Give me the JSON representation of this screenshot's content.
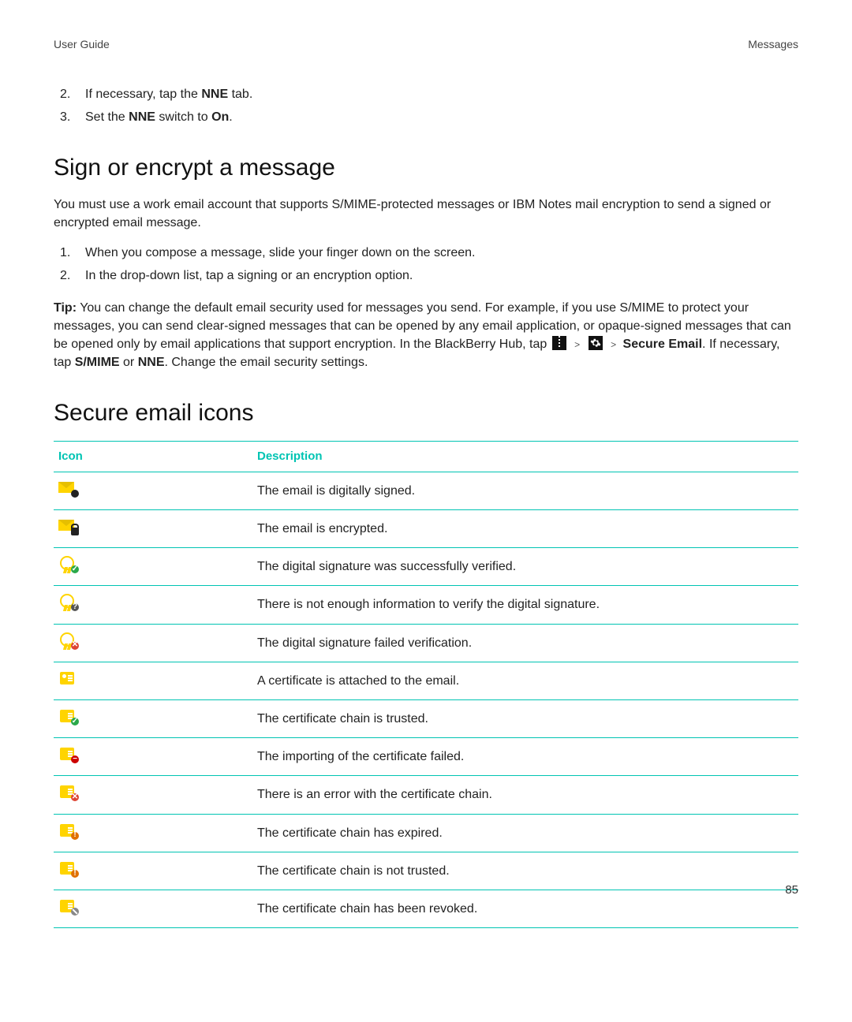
{
  "header": {
    "left": "User Guide",
    "right": "Messages"
  },
  "steps_top": [
    "If necessary, tap the **NNE** tab.",
    "Set the **NNE** switch to **On**."
  ],
  "section1": {
    "title": "Sign or encrypt a message",
    "intro": "You must use a work email account that supports S/MIME-protected messages or IBM Notes mail encryption to send a signed or encrypted email message.",
    "steps": [
      "When you compose a message, slide your finger down on the screen.",
      "In the drop-down list, tap a signing or an encryption option."
    ],
    "tip_prefix": "Tip:",
    "tip_body_a": " You can change the default email security used for messages you send. For example, if you use S/MIME to protect your messages, you can send clear-signed messages that can be opened by any email application, or opaque-signed messages that can be opened only by email applications that support encryption. In the BlackBerry Hub, tap ",
    "tip_secure_label": "Secure Email",
    "tip_body_b": ". If necessary, tap ",
    "tip_smime": "S/MIME",
    "tip_or": " or ",
    "tip_nne": "NNE",
    "tip_tail": ". Change the email security settings."
  },
  "section2": {
    "title": "Secure email icons",
    "columns": {
      "icon": "Icon",
      "desc": "Description"
    },
    "rows": [
      {
        "icon": "envelope-signed-icon",
        "desc": "The email is digitally signed."
      },
      {
        "icon": "envelope-encrypted-icon",
        "desc": "The email is encrypted."
      },
      {
        "icon": "signature-verified-icon",
        "desc": "The digital signature was successfully verified."
      },
      {
        "icon": "signature-unknown-icon",
        "desc": "There is not enough information to verify the digital signature."
      },
      {
        "icon": "signature-failed-icon",
        "desc": "The digital signature failed verification."
      },
      {
        "icon": "certificate-attached-icon",
        "desc": "A certificate is attached to the email."
      },
      {
        "icon": "cert-chain-trusted-icon",
        "desc": "The certificate chain is trusted."
      },
      {
        "icon": "cert-import-failed-icon",
        "desc": "The importing of the certificate failed."
      },
      {
        "icon": "cert-chain-error-icon",
        "desc": "There is an error with the certificate chain."
      },
      {
        "icon": "cert-chain-expired-icon",
        "desc": "The certificate chain has expired."
      },
      {
        "icon": "cert-chain-untrusted-icon",
        "desc": "The certificate chain is not trusted."
      },
      {
        "icon": "cert-chain-revoked-icon",
        "desc": "The certificate chain has been revoked."
      }
    ]
  },
  "page_number": "85",
  "colors": {
    "accent": "#00c4b3",
    "icon_yellow": "#ffd400"
  }
}
